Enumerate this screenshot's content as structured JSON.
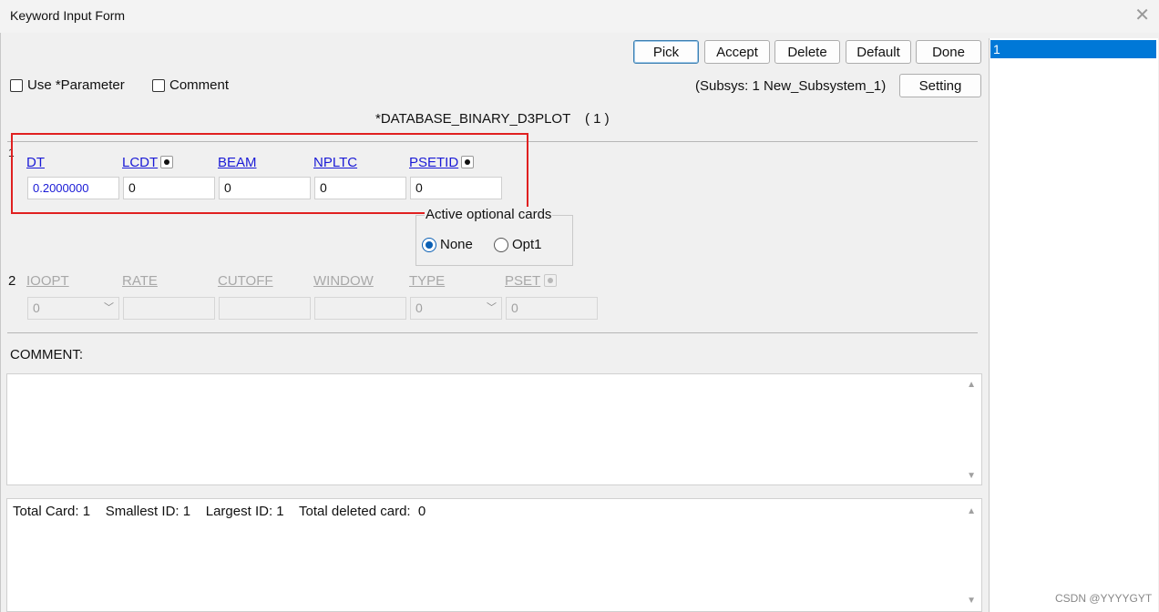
{
  "window": {
    "title": "Keyword Input Form"
  },
  "toolbar": {
    "pick": "Pick",
    "accept": "Accept",
    "delete": "Delete",
    "default": "Default",
    "done": "Done",
    "setting": "Setting"
  },
  "options": {
    "use_parameter": "Use *Parameter",
    "comment": "Comment"
  },
  "subsys": "(Subsys: 1 New_Subsystem_1)",
  "keyword": {
    "name": "*DATABASE_BINARY_D3PLOT",
    "count": "( 1 )"
  },
  "card1": {
    "row_label": "1",
    "fields": [
      {
        "label": "DT",
        "value": "0.2000000"
      },
      {
        "label": "LCDT",
        "value": "0"
      },
      {
        "label": "BEAM",
        "value": "0"
      },
      {
        "label": "NPLTC",
        "value": "0"
      },
      {
        "label": "PSETID",
        "value": "0"
      }
    ]
  },
  "optional": {
    "title": "Active optional cards",
    "none": "None",
    "opt1": "Opt1",
    "selected": "None"
  },
  "card2": {
    "row_label": "2",
    "fields": [
      {
        "label": "IOOPT",
        "value": "0"
      },
      {
        "label": "RATE",
        "value": ""
      },
      {
        "label": "CUTOFF",
        "value": ""
      },
      {
        "label": "WINDOW",
        "value": ""
      },
      {
        "label": "TYPE",
        "value": "0"
      },
      {
        "label": "PSET",
        "value": "0"
      }
    ]
  },
  "comment_label": "COMMENT:",
  "status": "Total Card: 1    Smallest ID: 1    Largest ID: 1    Total deleted card:  0",
  "id_list": [
    "1"
  ],
  "watermark": "CSDN @YYYYGYT"
}
